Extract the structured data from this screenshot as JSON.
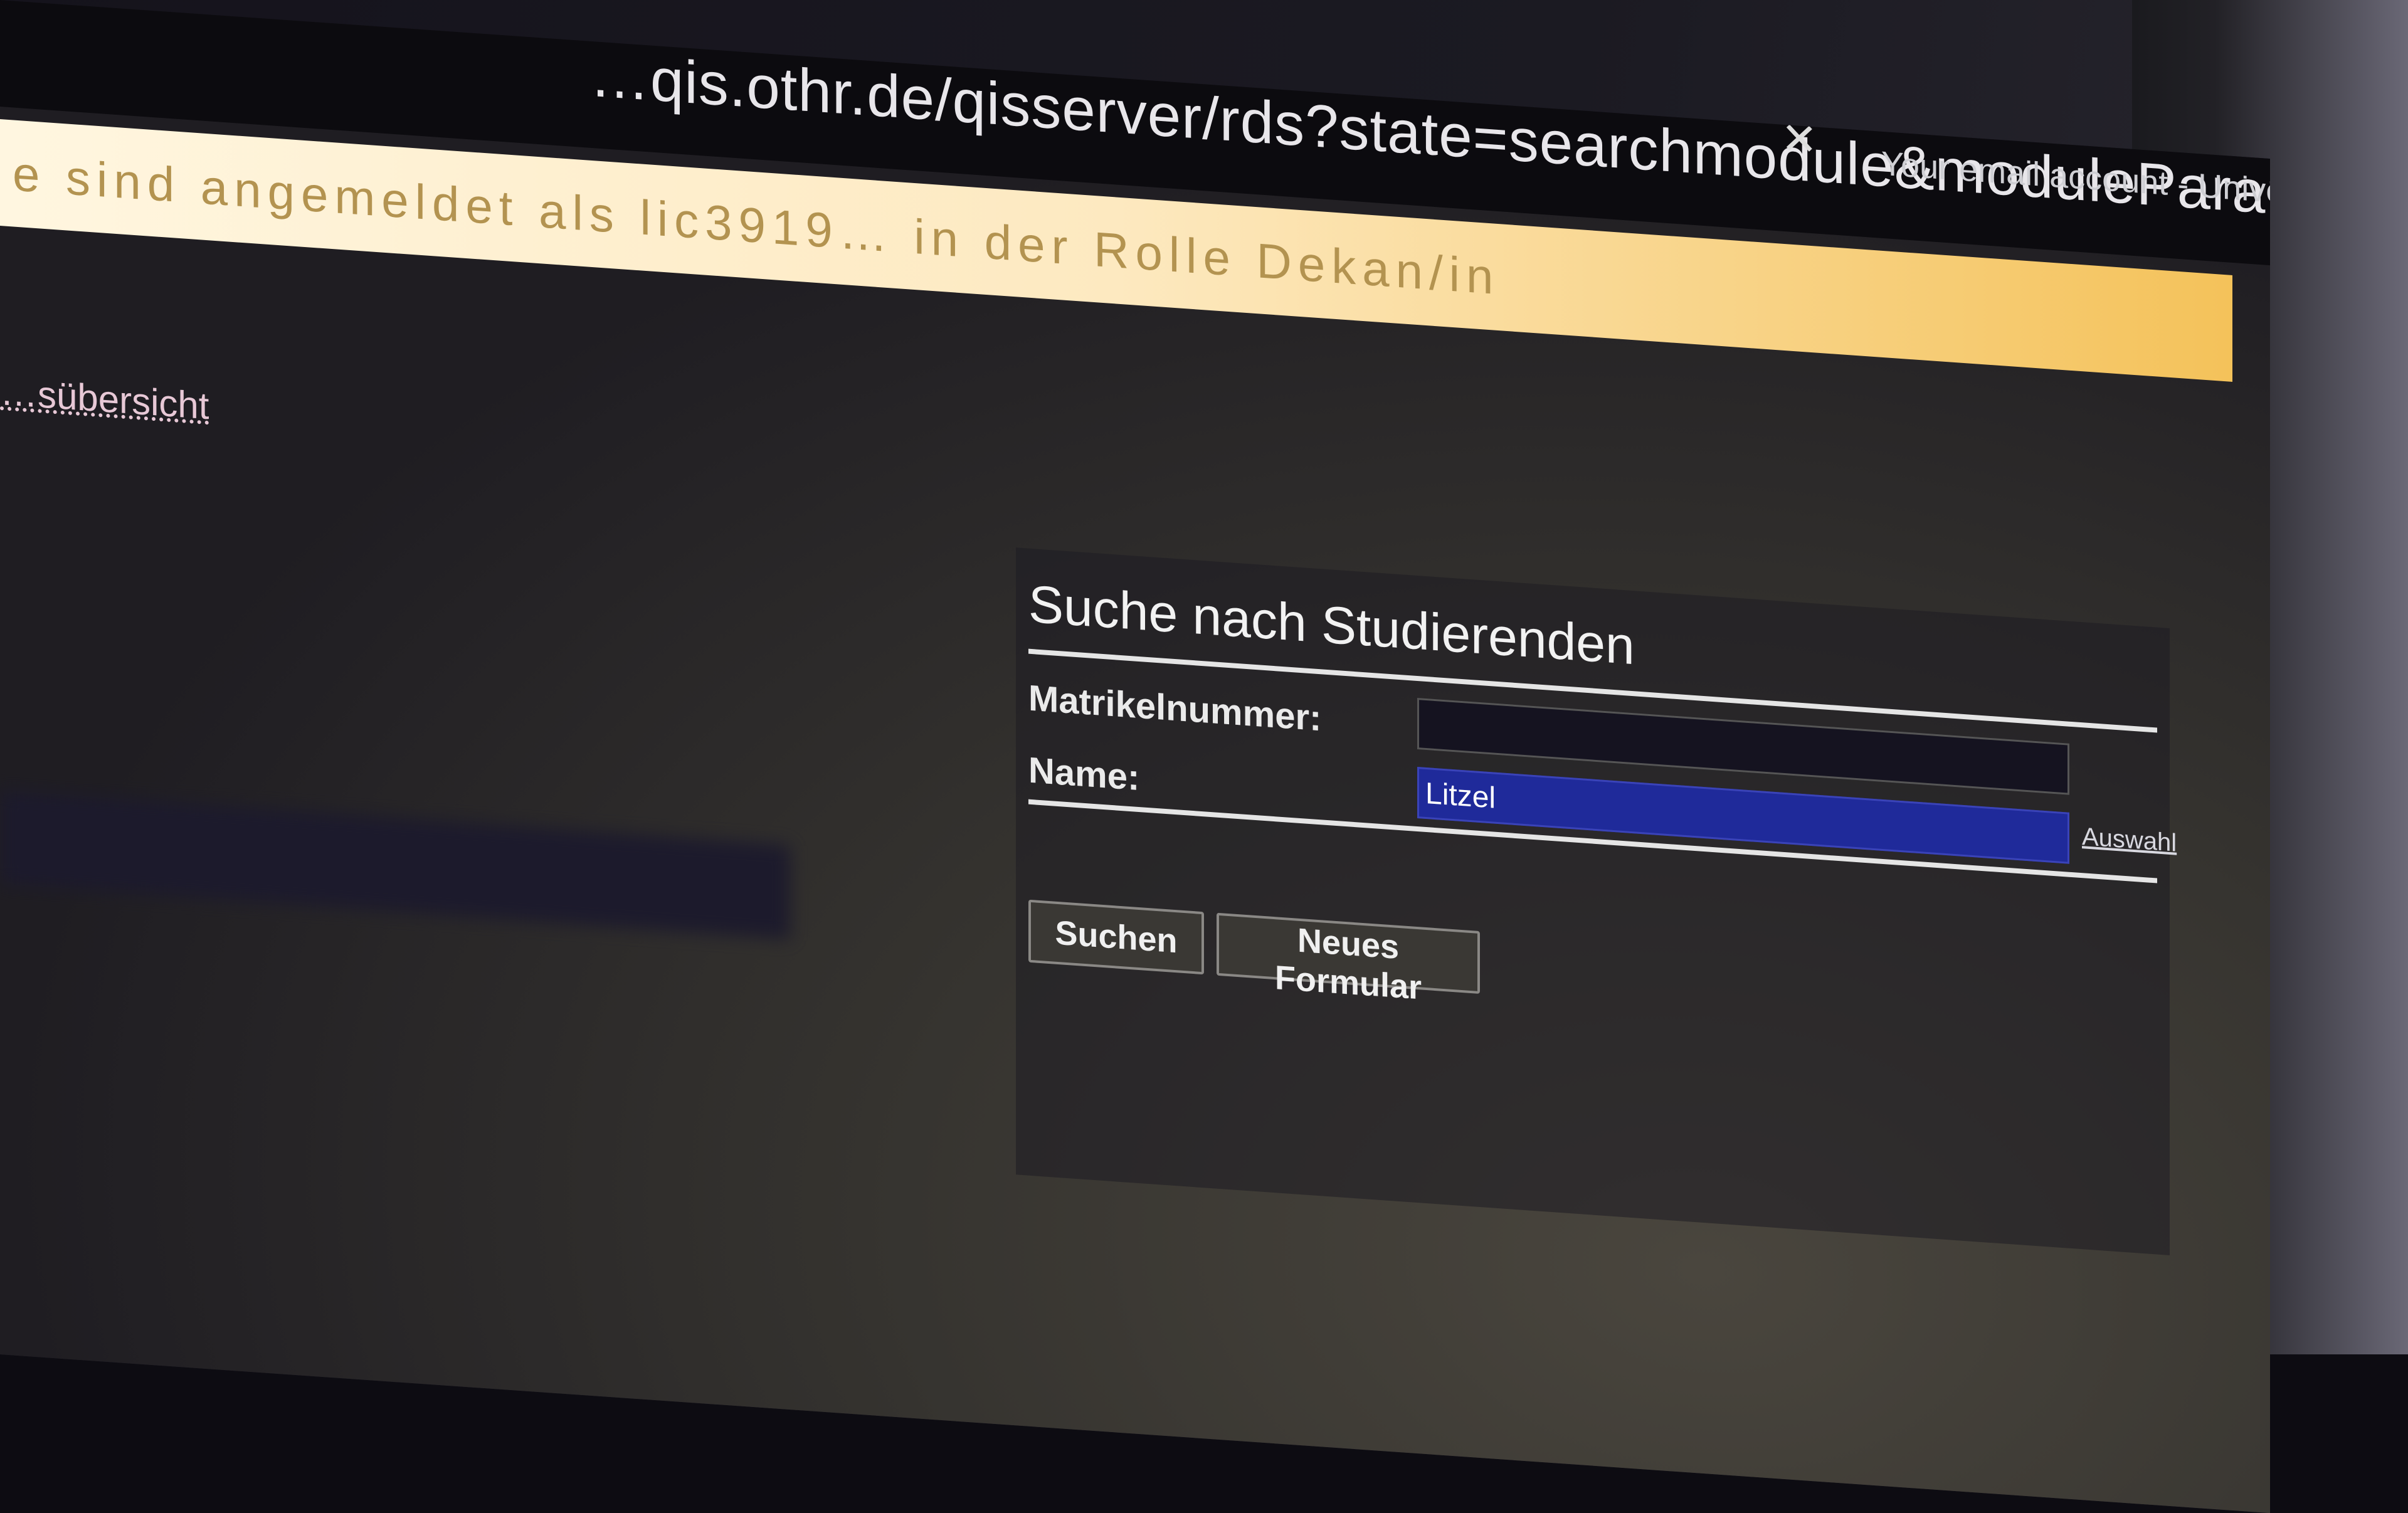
{
  "browser": {
    "url": "…qis.othr.de/qisserver/rds?state=searchmodule&moduleParameter=beratungDekan&do=",
    "tab_close_glyph": "✕",
    "tab_label": "Your email account - Universit…"
  },
  "header": {
    "login_banner": "e sind angemeldet als  lic3919…   in der Rolle  Dekan/in"
  },
  "sidebar": {
    "overview_link": "…sübersicht"
  },
  "form": {
    "title": "Suche nach Studierenden",
    "matrikel_label": "Matrikelnummer:",
    "matrikel_value": "",
    "name_label": "Name:",
    "name_value": "Litzel",
    "auswahl_link": "Auswahl",
    "search_button": "Suchen",
    "new_form_button": "Neues Formular"
  },
  "colors": {
    "banner_accent": "#f4c25a",
    "selected_input": "#1f2a9a"
  }
}
